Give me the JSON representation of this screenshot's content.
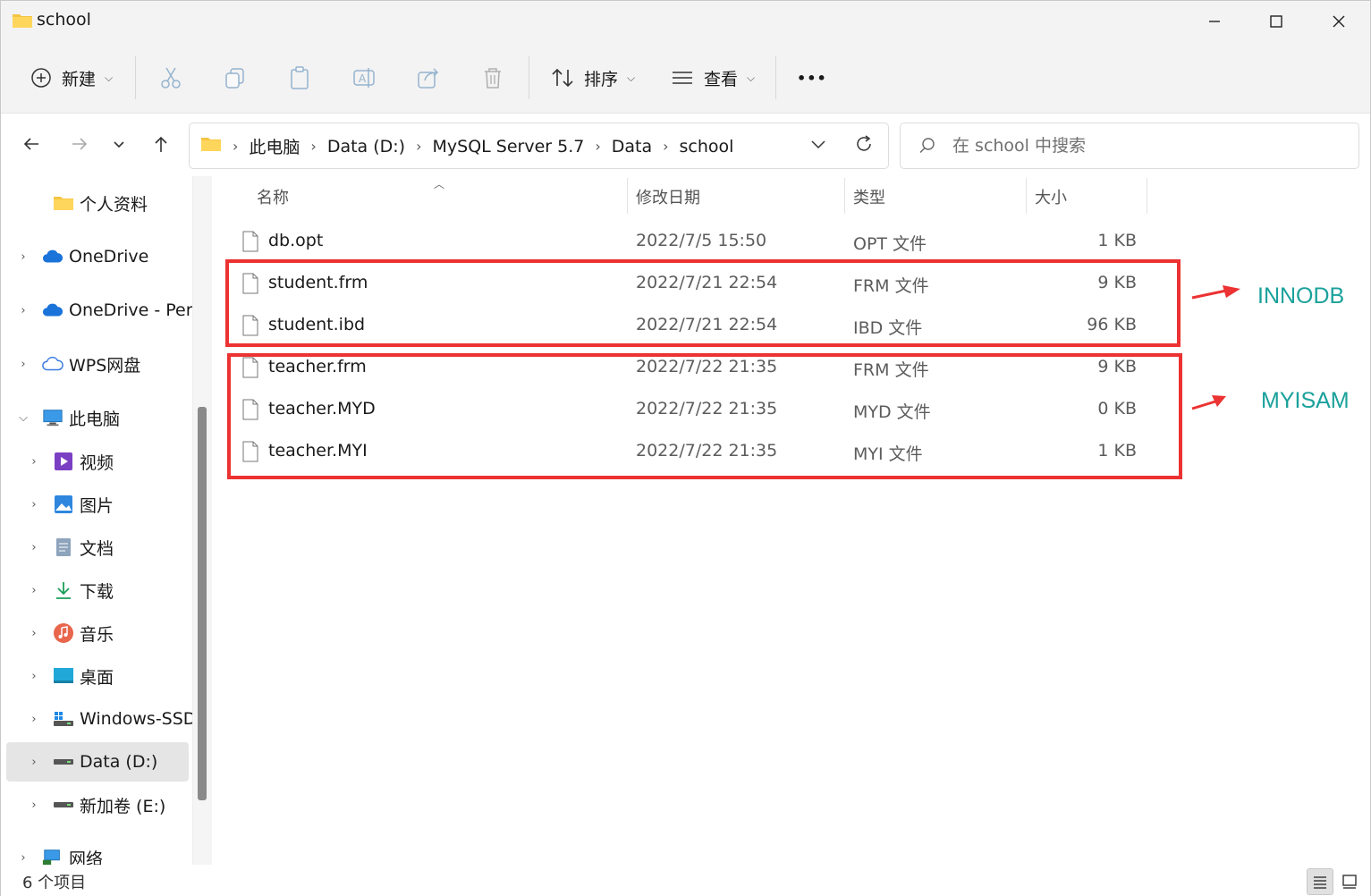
{
  "window": {
    "title": "school",
    "minimize_glyph": "—",
    "maximize_glyph": "☐",
    "close_glyph": "✕"
  },
  "toolbar": {
    "new_label": "新建",
    "sort_label": "排序",
    "view_label": "查看",
    "more_label": "•••"
  },
  "nav": {
    "breadcrumbs": [
      "此电脑",
      "Data (D:)",
      "MySQL Server 5.7",
      "Data",
      "school"
    ]
  },
  "search": {
    "placeholder": "在 school 中搜索"
  },
  "sidebar": {
    "items": [
      {
        "label": "个人资料",
        "icon": "folder-icon"
      },
      {
        "label": "OneDrive",
        "icon": "cloud-icon"
      },
      {
        "label": "OneDrive - Pers",
        "icon": "cloud-icon"
      },
      {
        "label": "WPS网盘",
        "icon": "cloud-outline-icon"
      },
      {
        "label": "此电脑",
        "icon": "computer-icon"
      },
      {
        "label": "视频",
        "icon": "video-icon"
      },
      {
        "label": "图片",
        "icon": "picture-icon"
      },
      {
        "label": "文档",
        "icon": "document-icon"
      },
      {
        "label": "下载",
        "icon": "download-icon"
      },
      {
        "label": "音乐",
        "icon": "music-icon"
      },
      {
        "label": "桌面",
        "icon": "desktop-icon"
      },
      {
        "label": "Windows-SSD",
        "icon": "drive-icon"
      },
      {
        "label": "Data (D:)",
        "icon": "drive-icon"
      },
      {
        "label": "新加卷 (E:)",
        "icon": "drive-icon"
      },
      {
        "label": "网络",
        "icon": "network-icon"
      }
    ]
  },
  "columns": {
    "name": "名称",
    "modified": "修改日期",
    "type": "类型",
    "size": "大小"
  },
  "files": [
    {
      "name": "db.opt",
      "modified": "2022/7/5 15:50",
      "type": "OPT 文件",
      "size": "1 KB"
    },
    {
      "name": "student.frm",
      "modified": "2022/7/21 22:54",
      "type": "FRM 文件",
      "size": "9 KB"
    },
    {
      "name": "student.ibd",
      "modified": "2022/7/21 22:54",
      "type": "IBD 文件",
      "size": "96 KB"
    },
    {
      "name": "teacher.frm",
      "modified": "2022/7/22 21:35",
      "type": "FRM 文件",
      "size": "9 KB"
    },
    {
      "name": "teacher.MYD",
      "modified": "2022/7/22 21:35",
      "type": "MYD 文件",
      "size": "0 KB"
    },
    {
      "name": "teacher.MYI",
      "modified": "2022/7/22 21:35",
      "type": "MYI 文件",
      "size": "1 KB"
    }
  ],
  "annotations": {
    "innodb_label": "INNODB",
    "myisam_label": "MYISAM",
    "box_color": "#ec3232",
    "label_color": "#1aa19b"
  },
  "status": {
    "item_count": "6 个项目"
  }
}
